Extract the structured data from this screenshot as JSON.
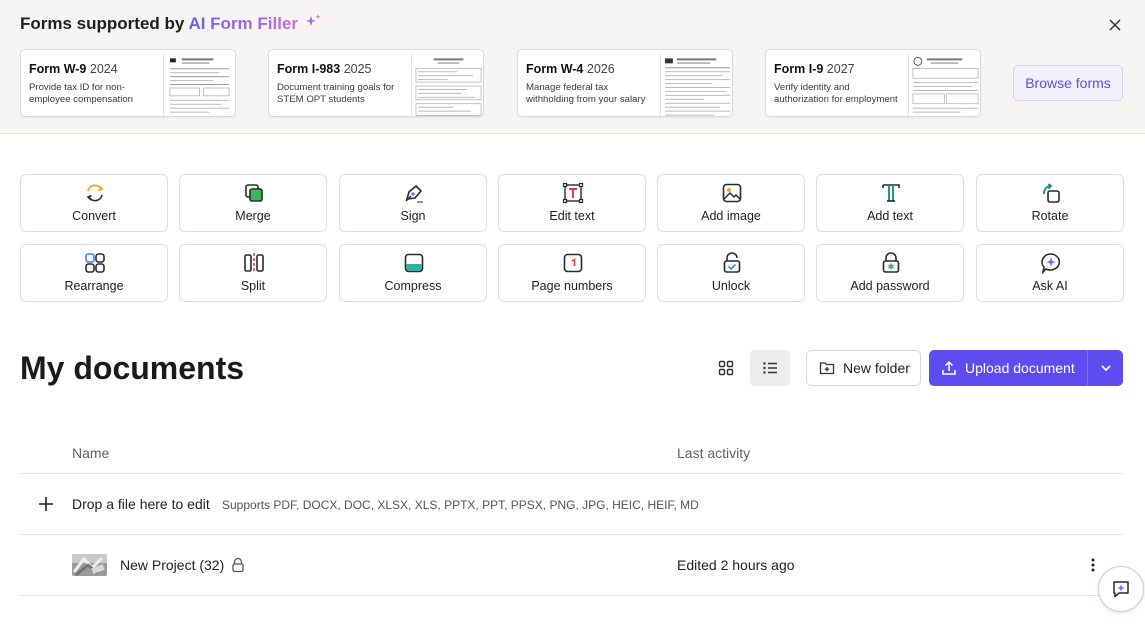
{
  "banner": {
    "title_prefix": "Forms supported by",
    "brand": "AI Form Filler",
    "close_icon": "close-icon",
    "forms": [
      {
        "name": "Form W-9",
        "year": "2024",
        "desc": "Provide tax ID for non-employee compensation"
      },
      {
        "name": "Form I-983",
        "year": "2025",
        "desc": "Document training goals for STEM OPT students"
      },
      {
        "name": "Form W-4",
        "year": "2026",
        "desc": "Manage federal tax withholding from your salary"
      },
      {
        "name": "Form I-9",
        "year": "2027",
        "desc": "Verify identity and authorization for employment"
      }
    ],
    "browse_label": "Browse forms"
  },
  "tools": [
    {
      "label": "Convert",
      "icon": "convert-icon"
    },
    {
      "label": "Merge",
      "icon": "merge-icon"
    },
    {
      "label": "Sign",
      "icon": "pen-icon"
    },
    {
      "label": "Edit text",
      "icon": "edit-text-icon"
    },
    {
      "label": "Add image",
      "icon": "image-icon"
    },
    {
      "label": "Add text",
      "icon": "text-icon"
    },
    {
      "label": "Rotate",
      "icon": "rotate-icon"
    },
    {
      "label": "Rearrange",
      "icon": "grid-icon"
    },
    {
      "label": "Split",
      "icon": "split-icon"
    },
    {
      "label": "Compress",
      "icon": "compress-icon"
    },
    {
      "label": "Page numbers",
      "icon": "page-number-icon"
    },
    {
      "label": "Unlock",
      "icon": "unlock-icon"
    },
    {
      "label": "Add password",
      "icon": "password-lock-icon"
    },
    {
      "label": "Ask AI",
      "icon": "ai-chat-icon"
    }
  ],
  "documents": {
    "title": "My documents",
    "new_folder_label": "New folder",
    "upload_label": "Upload document",
    "columns": {
      "name": "Name",
      "last_activity": "Last activity"
    },
    "drop_text": "Drop a file here to edit",
    "drop_supports": "Supports PDF, DOCX, DOC, XLSX, XLS, PPTX, PPT, PPSX, PNG, JPG, HEIC, HEIF, MD",
    "rows": [
      {
        "name": "New Project (32)",
        "locked": true,
        "activity": "Edited 2 hours ago"
      }
    ]
  },
  "colors": {
    "accent": "#5d4df0",
    "brand_gradient_start": "#6b5cf6",
    "brand_gradient_end": "#c86dd7",
    "banner_bg": "#f6f5f4"
  }
}
